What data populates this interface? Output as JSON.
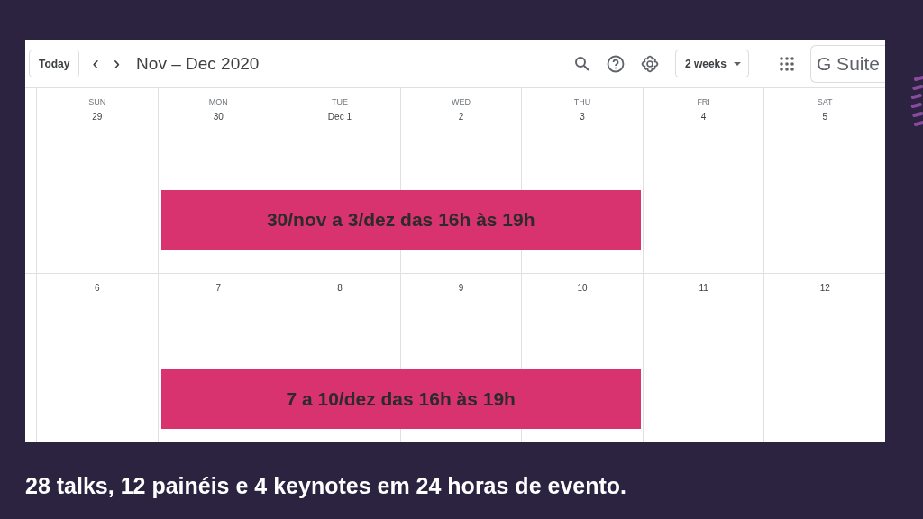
{
  "toolbar": {
    "today_button": "Today",
    "prev": "‹",
    "next": "›",
    "title": "Nov – Dec 2020",
    "view_select": "2 weeks",
    "brand": "G Suite"
  },
  "weeks": [
    {
      "days": [
        {
          "weekday": "SUN",
          "date": "29"
        },
        {
          "weekday": "MON",
          "date": "30"
        },
        {
          "weekday": "TUE",
          "date": "Dec 1"
        },
        {
          "weekday": "WED",
          "date": "2"
        },
        {
          "weekday": "THU",
          "date": "3"
        },
        {
          "weekday": "FRI",
          "date": "4"
        },
        {
          "weekday": "SAT",
          "date": "5"
        }
      ],
      "event": {
        "text": "30/nov a 3/dez das 16h às 19h",
        "color": "#d8336f"
      }
    },
    {
      "days": [
        {
          "date": "6"
        },
        {
          "date": "7"
        },
        {
          "date": "8"
        },
        {
          "date": "9"
        },
        {
          "date": "10"
        },
        {
          "date": "11"
        },
        {
          "date": "12"
        }
      ],
      "event": {
        "text": "7 a 10/dez das 16h às 19h",
        "color": "#d8336f"
      }
    }
  ],
  "caption": "28 talks, 12 painéis e 4 keynotes em 24 horas de evento."
}
